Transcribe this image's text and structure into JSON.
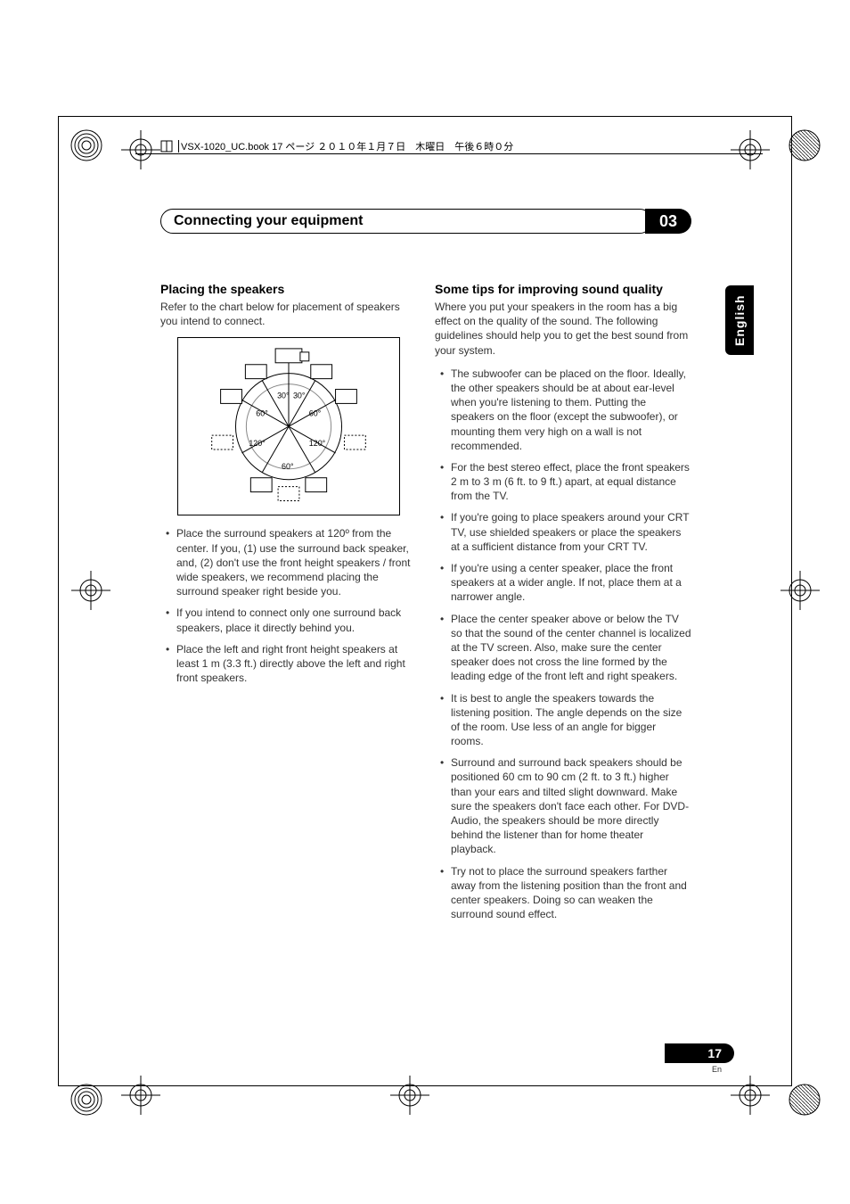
{
  "header": {
    "book_line": "VSX-1020_UC.book  17 ページ  ２０１０年１月７日　木曜日　午後６時０分"
  },
  "chapter": {
    "title": "Connecting your equipment",
    "number": "03"
  },
  "language_tab": "English",
  "left": {
    "heading": "Placing the speakers",
    "intro": "Refer to the chart below for placement of speakers you intend to connect.",
    "figure": {
      "angles": {
        "front_inner": "30°",
        "front_outer": "60°",
        "surround": "120°",
        "back": "60°"
      }
    },
    "bullets": [
      "Place the surround speakers at 120º from the center. If you, (1) use the surround back speaker, and, (2) don't use the front height speakers / front wide speakers, we recommend placing the surround speaker right beside you.",
      "If you intend to connect only one surround back speakers, place it directly behind you.",
      "Place the left and right front height speakers at least 1 m (3.3 ft.) directly above the left and right front speakers."
    ]
  },
  "right": {
    "heading": "Some tips for improving sound quality",
    "intro": "Where you put your speakers in the room has a big effect on the quality of the sound. The following guidelines should help you to get the best sound from your system.",
    "bullets": [
      "The subwoofer can be placed on the floor. Ideally, the other speakers should be at about ear-level when you're listening to them. Putting the speakers on the floor (except the subwoofer), or mounting them very high on a wall is not recommended.",
      "For the best stereo effect, place the front speakers 2 m to 3 m (6 ft. to 9 ft.) apart, at equal distance from the TV.",
      "If you're going to place speakers around your CRT TV, use shielded speakers or place the speakers at a sufficient distance from your CRT TV.",
      "If you're using a center speaker, place the front speakers at a wider angle. If not, place them at a narrower angle.",
      "Place the center speaker above or below the TV so that the sound of the center channel is localized at the TV screen. Also, make sure the center speaker does not cross the line formed by the leading edge of the front left and right speakers.",
      "It is best to angle the speakers towards the listening position. The angle depends on the size of the room. Use less of an angle for bigger rooms.",
      "Surround and surround back speakers should be positioned 60 cm to 90 cm (2 ft. to 3 ft.) higher than your ears and tilted slight downward. Make sure the speakers don't face each other. For DVD-Audio, the speakers should be more directly behind the listener than for home theater playback.",
      "Try not to place the surround speakers farther away from the listening position than the front and center speakers. Doing so can weaken the surround sound effect."
    ]
  },
  "footer": {
    "page_num": "17",
    "lang_short": "En"
  }
}
